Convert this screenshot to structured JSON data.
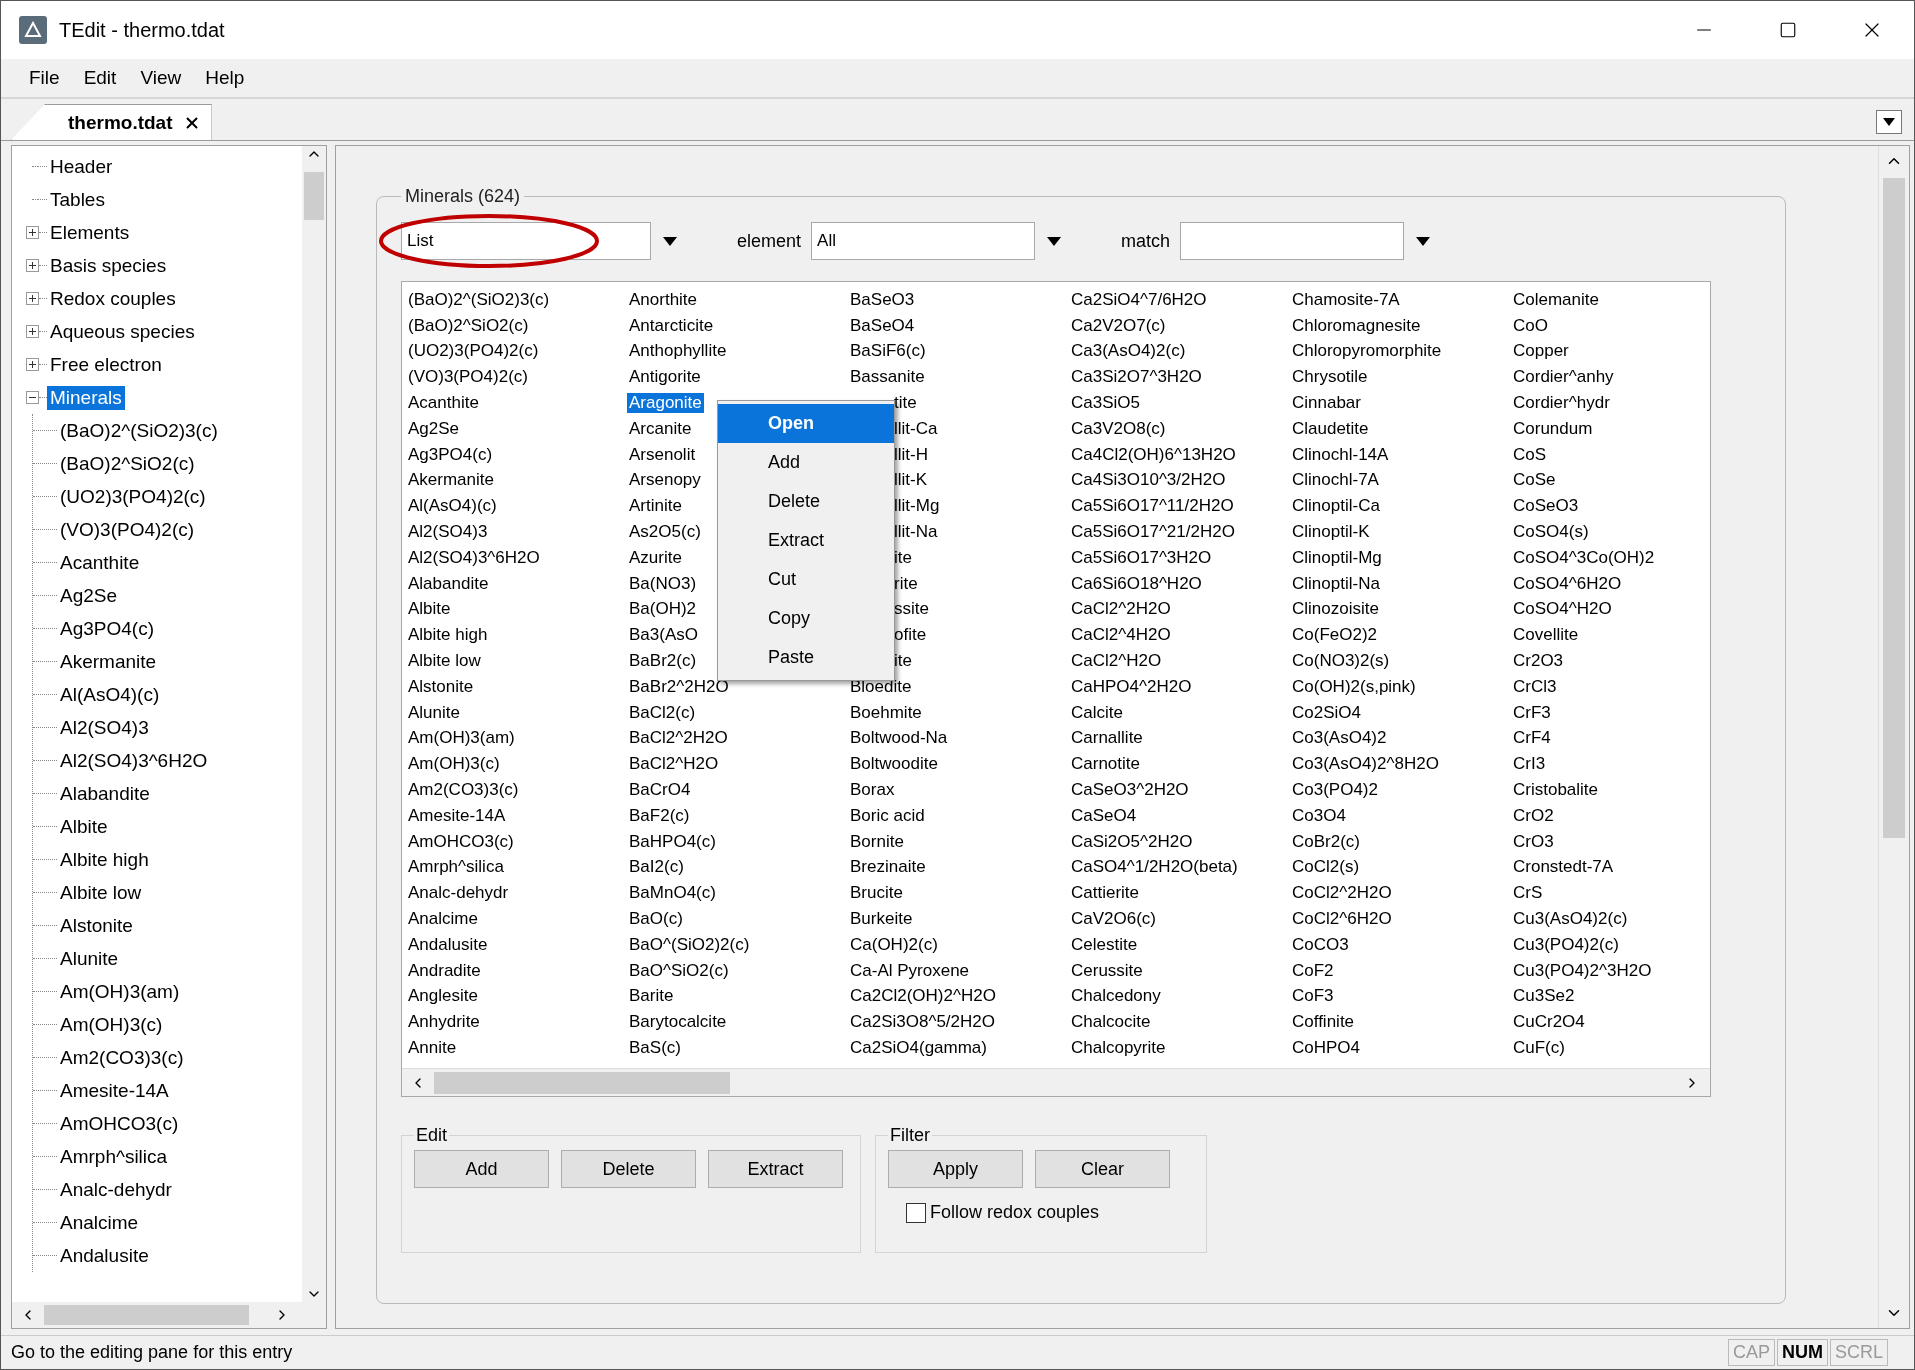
{
  "window": {
    "title": "TEdit - thermo.tdat"
  },
  "menu": [
    "File",
    "Edit",
    "View",
    "Help"
  ],
  "tabs": [
    {
      "label": "thermo.tdat",
      "selected": true
    }
  ],
  "tree": [
    {
      "label": "Header",
      "kind": "leaf",
      "selected": false
    },
    {
      "label": "Tables",
      "kind": "leaf",
      "selected": false
    },
    {
      "label": "Elements",
      "kind": "branch",
      "expanded": false,
      "selected": false
    },
    {
      "label": "Basis species",
      "kind": "branch",
      "expanded": false,
      "selected": false
    },
    {
      "label": "Redox couples",
      "kind": "branch",
      "expanded": false,
      "selected": false
    },
    {
      "label": "Aqueous species",
      "kind": "branch",
      "expanded": false,
      "selected": false
    },
    {
      "label": "Free electron",
      "kind": "branch",
      "expanded": false,
      "selected": false
    },
    {
      "label": "Minerals",
      "kind": "branch",
      "expanded": true,
      "selected": true,
      "children": [
        {
          "label": "(BaO)2^(SiO2)3(c)",
          "selected": false
        },
        {
          "label": "(BaO)2^SiO2(c)",
          "selected": false
        },
        {
          "label": "(UO2)3(PO4)2(c)",
          "selected": false
        },
        {
          "label": "(VO)3(PO4)2(c)",
          "selected": false
        },
        {
          "label": "Acanthite",
          "selected": false
        },
        {
          "label": "Ag2Se",
          "selected": false
        },
        {
          "label": "Ag3PO4(c)",
          "selected": false
        },
        {
          "label": "Akermanite",
          "selected": false
        },
        {
          "label": "Al(AsO4)(c)",
          "selected": false
        },
        {
          "label": "Al2(SO4)3",
          "selected": false
        },
        {
          "label": "Al2(SO4)3^6H2O",
          "selected": false
        },
        {
          "label": "Alabandite",
          "selected": false
        },
        {
          "label": "Albite",
          "selected": false
        },
        {
          "label": "Albite high",
          "selected": false
        },
        {
          "label": "Albite low",
          "selected": false
        },
        {
          "label": "Alstonite",
          "selected": false
        },
        {
          "label": "Alunite",
          "selected": false
        },
        {
          "label": "Am(OH)3(am)",
          "selected": false
        },
        {
          "label": "Am(OH)3(c)",
          "selected": false
        },
        {
          "label": "Am2(CO3)3(c)",
          "selected": false
        },
        {
          "label": "Amesite-14A",
          "selected": false
        },
        {
          "label": "AmOHCO3(c)",
          "selected": false
        },
        {
          "label": "Amrph^silica",
          "selected": false
        },
        {
          "label": "Analc-dehydr",
          "selected": false
        },
        {
          "label": "Analcime",
          "selected": false
        },
        {
          "label": "Andalusite",
          "selected": false
        }
      ]
    }
  ],
  "minerals": {
    "title": "Minerals (624)",
    "view_combo": "List",
    "annotation": {
      "kind": "ellipse"
    },
    "element_label": "element",
    "element_combo": "All",
    "match_label": "match",
    "list": {
      "columns": [
        [
          {
            "text": "(BaO)2^(SiO2)3(c)",
            "selected": false
          },
          {
            "text": "(BaO)2^SiO2(c)",
            "selected": false
          },
          {
            "text": "(UO2)3(PO4)2(c)",
            "selected": false
          },
          {
            "text": "(VO)3(PO4)2(c)",
            "selected": false
          },
          {
            "text": "Acanthite",
            "selected": false
          },
          {
            "text": "Ag2Se",
            "selected": false
          },
          {
            "text": "Ag3PO4(c)",
            "selected": false
          },
          {
            "text": "Akermanite",
            "selected": false
          },
          {
            "text": "Al(AsO4)(c)",
            "selected": false
          },
          {
            "text": "Al2(SO4)3",
            "selected": false
          },
          {
            "text": "Al2(SO4)3^6H2O",
            "selected": false
          },
          {
            "text": "Alabandite",
            "selected": false
          },
          {
            "text": "Albite",
            "selected": false
          },
          {
            "text": "Albite high",
            "selected": false
          },
          {
            "text": "Albite low",
            "selected": false
          },
          {
            "text": "Alstonite",
            "selected": false
          },
          {
            "text": "Alunite",
            "selected": false
          },
          {
            "text": "Am(OH)3(am)",
            "selected": false
          },
          {
            "text": "Am(OH)3(c)",
            "selected": false
          },
          {
            "text": "Am2(CO3)3(c)",
            "selected": false
          },
          {
            "text": "Amesite-14A",
            "selected": false
          },
          {
            "text": "AmOHCO3(c)",
            "selected": false
          },
          {
            "text": "Amrph^silica",
            "selected": false
          },
          {
            "text": "Analc-dehydr",
            "selected": false
          },
          {
            "text": "Analcime",
            "selected": false
          },
          {
            "text": "Andalusite",
            "selected": false
          },
          {
            "text": "Andradite",
            "selected": false
          },
          {
            "text": "Anglesite",
            "selected": false
          },
          {
            "text": "Anhydrite",
            "selected": false
          },
          {
            "text": "Annite",
            "selected": false
          }
        ],
        [
          {
            "text": "Anorthite",
            "selected": false
          },
          {
            "text": "Antarcticite",
            "selected": false
          },
          {
            "text": "Anthophyllite",
            "selected": false
          },
          {
            "text": "Antigorite",
            "selected": false
          },
          {
            "text": "Aragonite",
            "selected": true
          },
          {
            "text": "Arcanite",
            "selected": false
          },
          {
            "text": "Arsenolit",
            "selected": false
          },
          {
            "text": "Arsenopy",
            "selected": false
          },
          {
            "text": "Artinite",
            "selected": false
          },
          {
            "text": "As2O5(c)",
            "selected": false
          },
          {
            "text": "Azurite",
            "selected": false
          },
          {
            "text": "Ba(NO3)",
            "selected": false
          },
          {
            "text": "Ba(OH)2",
            "selected": false
          },
          {
            "text": "Ba3(AsO",
            "selected": false
          },
          {
            "text": "BaBr2(c)",
            "selected": false
          },
          {
            "text": "BaBr2^2H2O",
            "selected": false
          },
          {
            "text": "BaCl2(c)",
            "selected": false
          },
          {
            "text": "BaCl2^2H2O",
            "selected": false
          },
          {
            "text": "BaCl2^H2O",
            "selected": false
          },
          {
            "text": "BaCrO4",
            "selected": false
          },
          {
            "text": "BaF2(c)",
            "selected": false
          },
          {
            "text": "BaHPO4(c)",
            "selected": false
          },
          {
            "text": "BaI2(c)",
            "selected": false
          },
          {
            "text": "BaMnO4(c)",
            "selected": false
          },
          {
            "text": "BaO(c)",
            "selected": false
          },
          {
            "text": "BaO^(SiO2)2(c)",
            "selected": false
          },
          {
            "text": "BaO^SiO2(c)",
            "selected": false
          },
          {
            "text": "Barite",
            "selected": false
          },
          {
            "text": "Barytocalcite",
            "selected": false
          },
          {
            "text": "BaS(c)",
            "selected": false
          }
        ],
        [
          {
            "text": "BaSeO3",
            "selected": false
          },
          {
            "text": "BaSeO4",
            "selected": false
          },
          {
            "text": "BaSiF6(c)",
            "selected": false
          },
          {
            "text": "Bassanite",
            "selected": false
          },
          {
            "text": "tite",
            "selected": false
          },
          {
            "text": "llit-Ca",
            "selected": false
          },
          {
            "text": "llit-H",
            "selected": false
          },
          {
            "text": "llit-K",
            "selected": false
          },
          {
            "text": "llit-Mg",
            "selected": false
          },
          {
            "text": "llit-Na",
            "selected": false
          },
          {
            "text": "ite",
            "selected": false
          },
          {
            "text": "rite",
            "selected": false
          },
          {
            "text": "ssite",
            "selected": false
          },
          {
            "text": "ofite",
            "selected": false
          },
          {
            "text": "ite",
            "selected": false
          },
          {
            "text": "Bloedite",
            "selected": false
          },
          {
            "text": "Boehmite",
            "selected": false
          },
          {
            "text": "Boltwood-Na",
            "selected": false
          },
          {
            "text": "Boltwoodite",
            "selected": false
          },
          {
            "text": "Borax",
            "selected": false
          },
          {
            "text": "Boric acid",
            "selected": false
          },
          {
            "text": "Bornite",
            "selected": false
          },
          {
            "text": "Brezinaite",
            "selected": false
          },
          {
            "text": "Brucite",
            "selected": false
          },
          {
            "text": "Burkeite",
            "selected": false
          },
          {
            "text": "Ca(OH)2(c)",
            "selected": false
          },
          {
            "text": "Ca-Al Pyroxene",
            "selected": false
          },
          {
            "text": "Ca2Cl2(OH)2^H2O",
            "selected": false
          },
          {
            "text": "Ca2Si3O8^5/2H2O",
            "selected": false
          },
          {
            "text": "Ca2SiO4(gamma)",
            "selected": false
          }
        ],
        [
          {
            "text": "Ca2SiO4^7/6H2O",
            "selected": false
          },
          {
            "text": "Ca2V2O7(c)",
            "selected": false
          },
          {
            "text": "Ca3(AsO4)2(c)",
            "selected": false
          },
          {
            "text": "Ca3Si2O7^3H2O",
            "selected": false
          },
          {
            "text": "Ca3SiO5",
            "selected": false
          },
          {
            "text": "Ca3V2O8(c)",
            "selected": false
          },
          {
            "text": "Ca4Cl2(OH)6^13H2O",
            "selected": false
          },
          {
            "text": "Ca4Si3O10^3/2H2O",
            "selected": false
          },
          {
            "text": "Ca5Si6O17^11/2H2O",
            "selected": false
          },
          {
            "text": "Ca5Si6O17^21/2H2O",
            "selected": false
          },
          {
            "text": "Ca5Si6O17^3H2O",
            "selected": false
          },
          {
            "text": "Ca6Si6O18^H2O",
            "selected": false
          },
          {
            "text": "CaCl2^2H2O",
            "selected": false
          },
          {
            "text": "CaCl2^4H2O",
            "selected": false
          },
          {
            "text": "CaCl2^H2O",
            "selected": false
          },
          {
            "text": "CaHPO4^2H2O",
            "selected": false
          },
          {
            "text": "Calcite",
            "selected": false
          },
          {
            "text": "Carnallite",
            "selected": false
          },
          {
            "text": "Carnotite",
            "selected": false
          },
          {
            "text": "CaSeO3^2H2O",
            "selected": false
          },
          {
            "text": "CaSeO4",
            "selected": false
          },
          {
            "text": "CaSi2O5^2H2O",
            "selected": false
          },
          {
            "text": "CaSO4^1/2H2O(beta)",
            "selected": false
          },
          {
            "text": "Cattierite",
            "selected": false
          },
          {
            "text": "CaV2O6(c)",
            "selected": false
          },
          {
            "text": "Celestite",
            "selected": false
          },
          {
            "text": "Cerussite",
            "selected": false
          },
          {
            "text": "Chalcedony",
            "selected": false
          },
          {
            "text": "Chalcocite",
            "selected": false
          },
          {
            "text": "Chalcopyrite",
            "selected": false
          }
        ],
        [
          {
            "text": "Chamosite-7A",
            "selected": false
          },
          {
            "text": "Chloromagnesite",
            "selected": false
          },
          {
            "text": "Chloropyromorphite",
            "selected": false
          },
          {
            "text": "Chrysotile",
            "selected": false
          },
          {
            "text": "Cinnabar",
            "selected": false
          },
          {
            "text": "Claudetite",
            "selected": false
          },
          {
            "text": "Clinochl-14A",
            "selected": false
          },
          {
            "text": "Clinochl-7A",
            "selected": false
          },
          {
            "text": "Clinoptil-Ca",
            "selected": false
          },
          {
            "text": "Clinoptil-K",
            "selected": false
          },
          {
            "text": "Clinoptil-Mg",
            "selected": false
          },
          {
            "text": "Clinoptil-Na",
            "selected": false
          },
          {
            "text": "Clinozoisite",
            "selected": false
          },
          {
            "text": "Co(FeO2)2",
            "selected": false
          },
          {
            "text": "Co(NO3)2(s)",
            "selected": false
          },
          {
            "text": "Co(OH)2(s,pink)",
            "selected": false
          },
          {
            "text": "Co2SiO4",
            "selected": false
          },
          {
            "text": "Co3(AsO4)2",
            "selected": false
          },
          {
            "text": "Co3(AsO4)2^8H2O",
            "selected": false
          },
          {
            "text": "Co3(PO4)2",
            "selected": false
          },
          {
            "text": "Co3O4",
            "selected": false
          },
          {
            "text": "CoBr2(c)",
            "selected": false
          },
          {
            "text": "CoCl2(s)",
            "selected": false
          },
          {
            "text": "CoCl2^2H2O",
            "selected": false
          },
          {
            "text": "CoCl2^6H2O",
            "selected": false
          },
          {
            "text": "CoCO3",
            "selected": false
          },
          {
            "text": "CoF2",
            "selected": false
          },
          {
            "text": "CoF3",
            "selected": false
          },
          {
            "text": "Coffinite",
            "selected": false
          },
          {
            "text": "CoHPO4",
            "selected": false
          }
        ],
        [
          {
            "text": "Colemanite",
            "selected": false
          },
          {
            "text": "CoO",
            "selected": false
          },
          {
            "text": "Copper",
            "selected": false
          },
          {
            "text": "Cordier^anhy",
            "selected": false
          },
          {
            "text": "Cordier^hydr",
            "selected": false
          },
          {
            "text": "Corundum",
            "selected": false
          },
          {
            "text": "CoS",
            "selected": false
          },
          {
            "text": "CoSe",
            "selected": false
          },
          {
            "text": "CoSeO3",
            "selected": false
          },
          {
            "text": "CoSO4(s)",
            "selected": false
          },
          {
            "text": "CoSO4^3Co(OH)2",
            "selected": false
          },
          {
            "text": "CoSO4^6H2O",
            "selected": false
          },
          {
            "text": "CoSO4^H2O",
            "selected": false
          },
          {
            "text": "Covellite",
            "selected": false
          },
          {
            "text": "Cr2O3",
            "selected": false
          },
          {
            "text": "CrCl3",
            "selected": false
          },
          {
            "text": "CrF3",
            "selected": false
          },
          {
            "text": "CrF4",
            "selected": false
          },
          {
            "text": "CrI3",
            "selected": false
          },
          {
            "text": "Cristobalite",
            "selected": false
          },
          {
            "text": "CrO2",
            "selected": false
          },
          {
            "text": "CrO3",
            "selected": false
          },
          {
            "text": "Cronstedt-7A",
            "selected": false
          },
          {
            "text": "CrS",
            "selected": false
          },
          {
            "text": "Cu3(AsO4)2(c)",
            "selected": false
          },
          {
            "text": "Cu3(PO4)2(c)",
            "selected": false
          },
          {
            "text": "Cu3(PO4)2^3H2O",
            "selected": false
          },
          {
            "text": "Cu3Se2",
            "selected": false
          },
          {
            "text": "CuCr2O4",
            "selected": false
          },
          {
            "text": "CuF(c)",
            "selected": false
          }
        ]
      ]
    },
    "context_menu": [
      {
        "label": "Open",
        "selected": true
      },
      {
        "label": "Add",
        "selected": false
      },
      {
        "label": "Delete",
        "selected": false
      },
      {
        "label": "Extract",
        "selected": false
      },
      {
        "label": "Cut",
        "selected": false
      },
      {
        "label": "Copy",
        "selected": false
      },
      {
        "label": "Paste",
        "selected": false
      }
    ],
    "edit_group": {
      "title": "Edit",
      "buttons": [
        "Add",
        "Delete",
        "Extract"
      ]
    },
    "filter_group": {
      "title": "Filter",
      "buttons": [
        "Apply",
        "Clear"
      ],
      "checkbox": {
        "label": "Follow redox couples",
        "checked": false
      }
    }
  },
  "status_bar": {
    "message": "Go to the editing pane for this entry",
    "indicators": [
      {
        "label": "CAP",
        "on": false
      },
      {
        "label": "NUM",
        "on": true
      },
      {
        "label": "SCRL",
        "on": false
      }
    ]
  }
}
